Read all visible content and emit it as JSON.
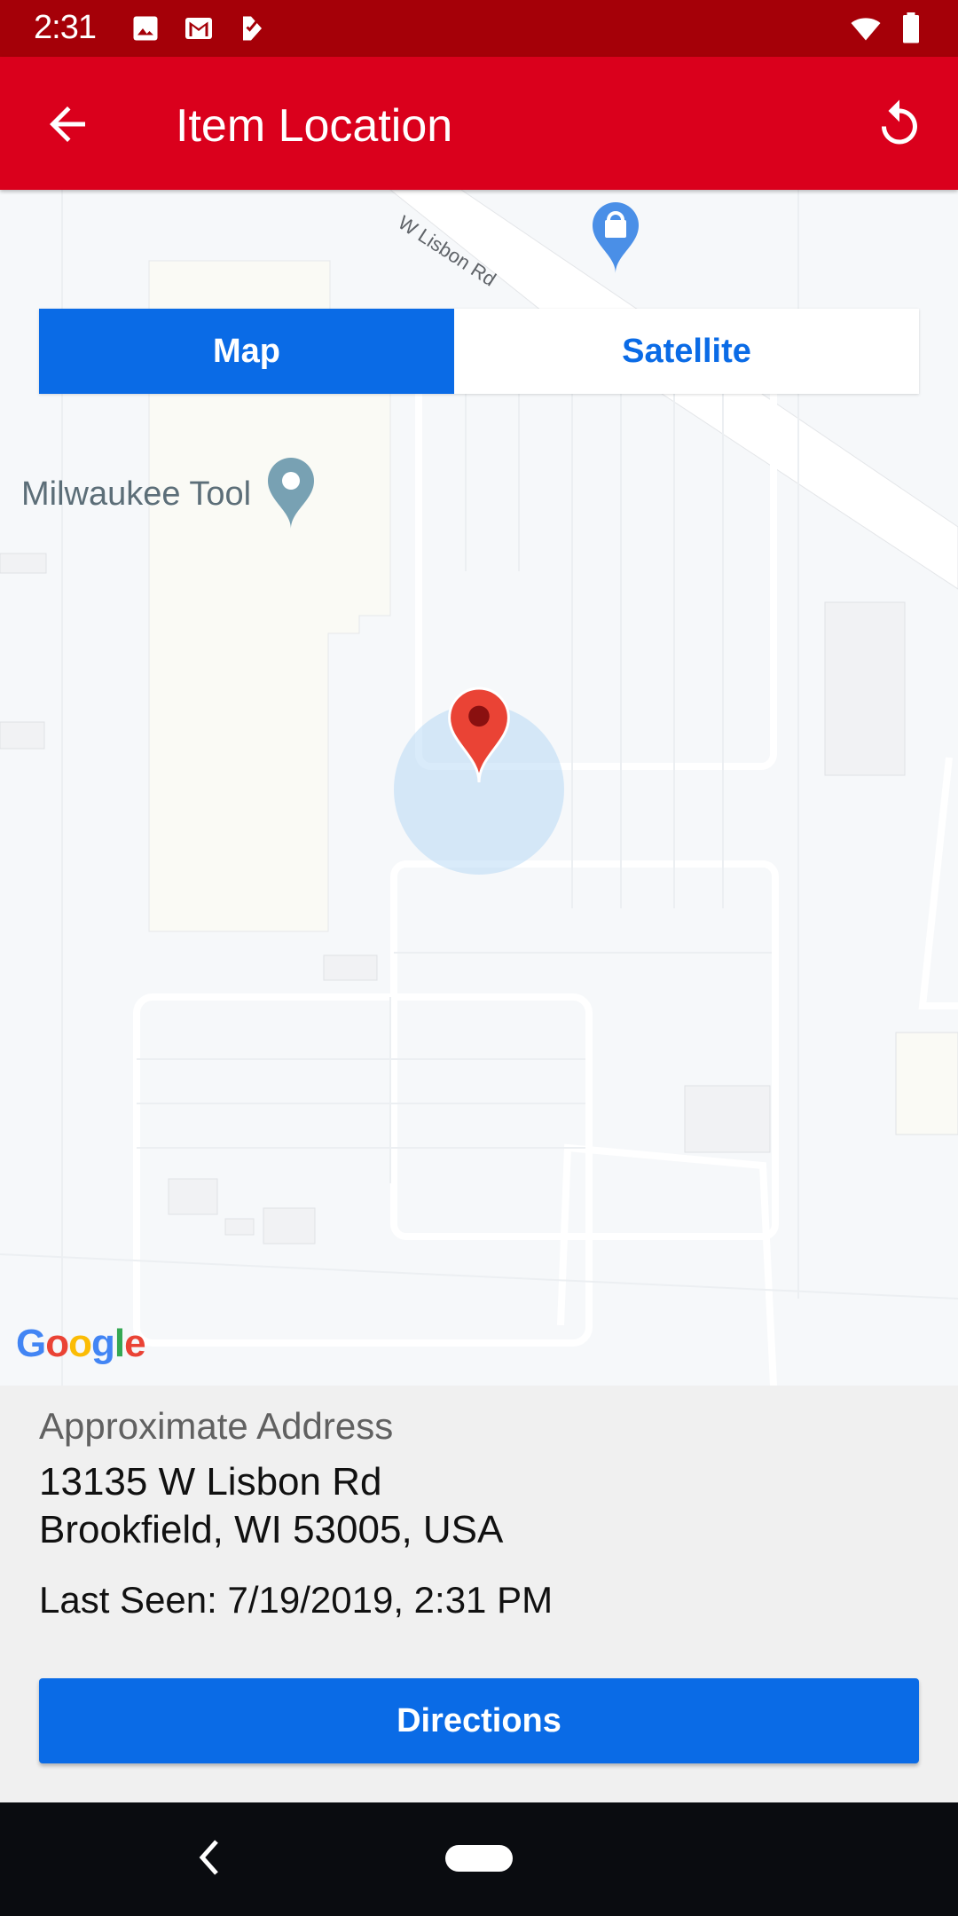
{
  "status_bar": {
    "time": "2:31",
    "left_icons": [
      "image-notification-icon",
      "gmail-icon",
      "task-icon"
    ],
    "right_icons": [
      "wifi-icon",
      "battery-icon"
    ]
  },
  "app_bar": {
    "title": "Item Location",
    "back_icon": "arrow-back-icon",
    "refresh_icon": "refresh-icon",
    "color": "#da001c"
  },
  "map": {
    "view_toggle": {
      "options": [
        {
          "label": "Map",
          "selected": true
        },
        {
          "label": "Satellite",
          "selected": false
        }
      ]
    },
    "road_label": "W Lisbon Rd",
    "poi": {
      "label": "Milwaukee Tool",
      "icon": "place-pin-icon"
    },
    "shopping_poi_icon": "shopping-bag-pin-icon",
    "location_marker_icon": "red-location-pin-icon",
    "attribution": "Google",
    "accent": "#0a6be6"
  },
  "info": {
    "label": "Approximate Address",
    "address_line1": "13135 W Lisbon Rd",
    "address_line2": "Brookfield, WI 53005, USA",
    "last_seen": "Last Seen: 7/19/2019, 2:31 PM",
    "directions_label": "Directions"
  },
  "nav_bar": {
    "back_icon": "nav-back-icon",
    "home_icon": "nav-home-pill"
  }
}
